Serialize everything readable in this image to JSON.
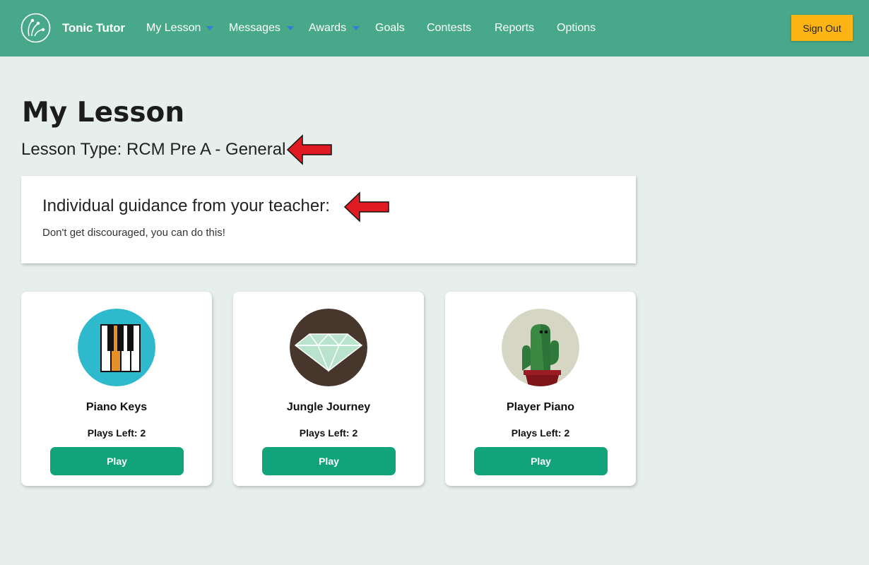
{
  "header": {
    "brand": "Tonic Tutor",
    "nav": [
      {
        "label": "My Lesson"
      },
      {
        "label": "Messages"
      },
      {
        "label": "Awards"
      },
      {
        "label": "Goals"
      },
      {
        "label": "Contests"
      },
      {
        "label": "Reports"
      },
      {
        "label": "Options"
      }
    ],
    "sign_out_label": "Sign Out"
  },
  "main": {
    "title": "My Lesson",
    "lesson_type": "Lesson Type: RCM Pre A - General",
    "guidance": {
      "heading": "Individual guidance from your teacher:",
      "message": "Don't get discouraged, you can do this!"
    },
    "games": [
      {
        "title": "Piano Keys",
        "plays_left": "Plays Left: 2",
        "play_label": "Play",
        "icon": "piano-keys-icon"
      },
      {
        "title": "Jungle Journey",
        "plays_left": "Plays Left: 2",
        "play_label": "Play",
        "icon": "diamond-icon"
      },
      {
        "title": "Player Piano",
        "plays_left": "Plays Left: 2",
        "play_label": "Play",
        "icon": "cactus-icon"
      }
    ]
  },
  "colors": {
    "header": "#48a98a",
    "background": "#e7efed",
    "sign_out": "#fdb515",
    "play_button": "#11a37a",
    "annotation_arrow": "#e01b24",
    "nav_caret": "#2f7fd6"
  }
}
